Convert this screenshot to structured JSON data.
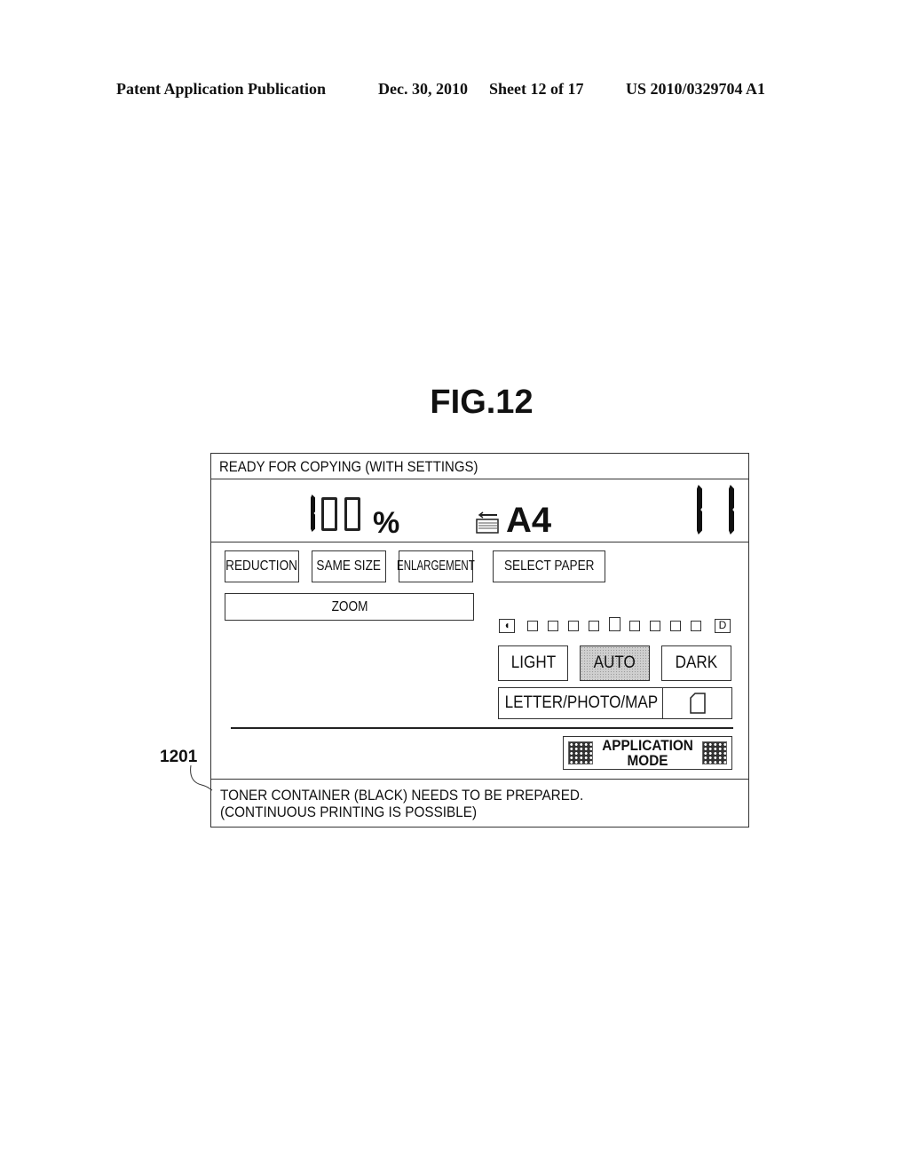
{
  "header": {
    "publication": "Patent Application Publication",
    "date": "Dec. 30, 2010",
    "sheet": "Sheet 12 of 17",
    "number": "US 2010/0329704 A1"
  },
  "figure": {
    "title": "FIG.12",
    "reference_label": "1201"
  },
  "panel": {
    "status": "READY FOR COPYING (WITH SETTINGS)",
    "display": {
      "zoom_value": "100",
      "zoom_unit": "%",
      "tray_icon": "paper-tray-icon",
      "paper_size": "A4",
      "copy_count": "11"
    },
    "buttons": {
      "reduction": "REDUCTION",
      "same_size": "SAME SIZE",
      "enlargement": "ENLARGEMENT",
      "select_paper": "SELECT PAPER",
      "zoom": "ZOOM",
      "light": "LIGHT",
      "auto": "AUTO",
      "dark": "DARK",
      "original_type": "LETTER/PHOTO/MAP",
      "original_type_icon": "document-icon",
      "application_mode_line1": "APPLICATION",
      "application_mode_line2": "MODE"
    },
    "density": {
      "left_symbol": "light-end-icon",
      "right_symbol": "dark-end-icon",
      "levels": 9,
      "current_level": 5,
      "auto_selected": true
    },
    "message": {
      "line1": "TONER CONTAINER (BLACK) NEEDS TO BE PREPARED.",
      "line2": "(CONTINUOUS PRINTING IS POSSIBLE)"
    }
  }
}
